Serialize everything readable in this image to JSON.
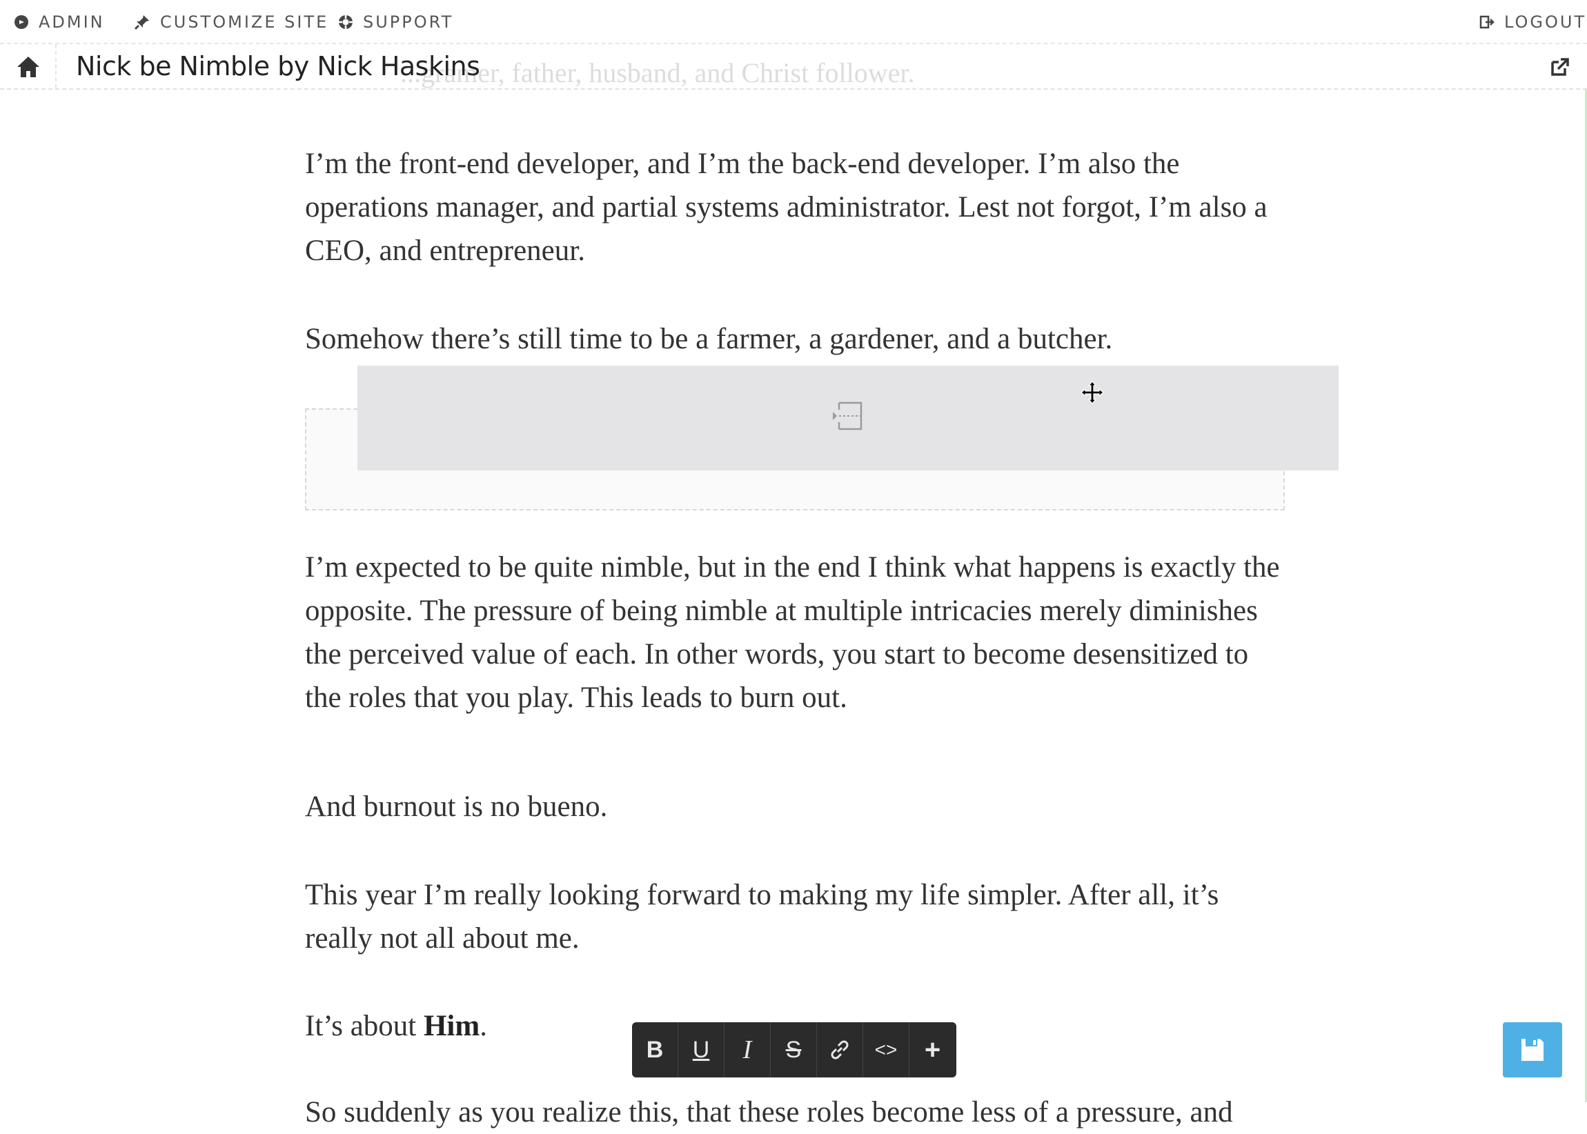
{
  "adminbar": {
    "admin": "ADMIN",
    "customize": "CUSTOMIZE SITE",
    "support": "SUPPORT",
    "logout": "LOGOUT"
  },
  "titlebar": {
    "title": "Nick be Nimble by Nick Haskins",
    "ghost_text": "...gramer, father, husband, and Christ follower."
  },
  "content": {
    "p1": "I’m the front-end developer, and I’m the back-end developer. I’m also the operations manager, and partial systems administrator. Lest not forgot, I’m also a CEO, and entrepreneur.",
    "p2": "Somehow there’s still time to be a farmer, a gardener, and a butcher.",
    "p3": "I’m expected to be quite nimble, but in the end I think what happens is exactly the opposite. The pressure of being nimble at multiple intricacies merely diminishes the perceived value of each. In other words, you start to become desensitized to the roles that you play. This leads to burn out.",
    "p4": "And burnout is no bueno.",
    "p5": "This year I’m really looking forward to making my life simpler. After all, it’s really not all about me.",
    "p6_prefix": "It’s about ",
    "p6_bold": "Him",
    "p6_suffix": ".",
    "p7": "So suddenly as you realize this, that these roles become less of a pressure, and"
  },
  "toolbar": {
    "bold": "B",
    "underline": "U",
    "italic": "I",
    "strike": "S",
    "link_icon": "link-icon",
    "code": "<>",
    "add": "+"
  },
  "icons": [
    "admin-icon",
    "pin-icon",
    "support-icon",
    "logout-icon",
    "home-icon",
    "external-link-icon",
    "placeholder-icon",
    "move-cursor-icon",
    "save-icon"
  ],
  "colors": {
    "accent": "#4fb0e6",
    "toolbar_bg": "#2b2b2b",
    "text": "#333333"
  }
}
